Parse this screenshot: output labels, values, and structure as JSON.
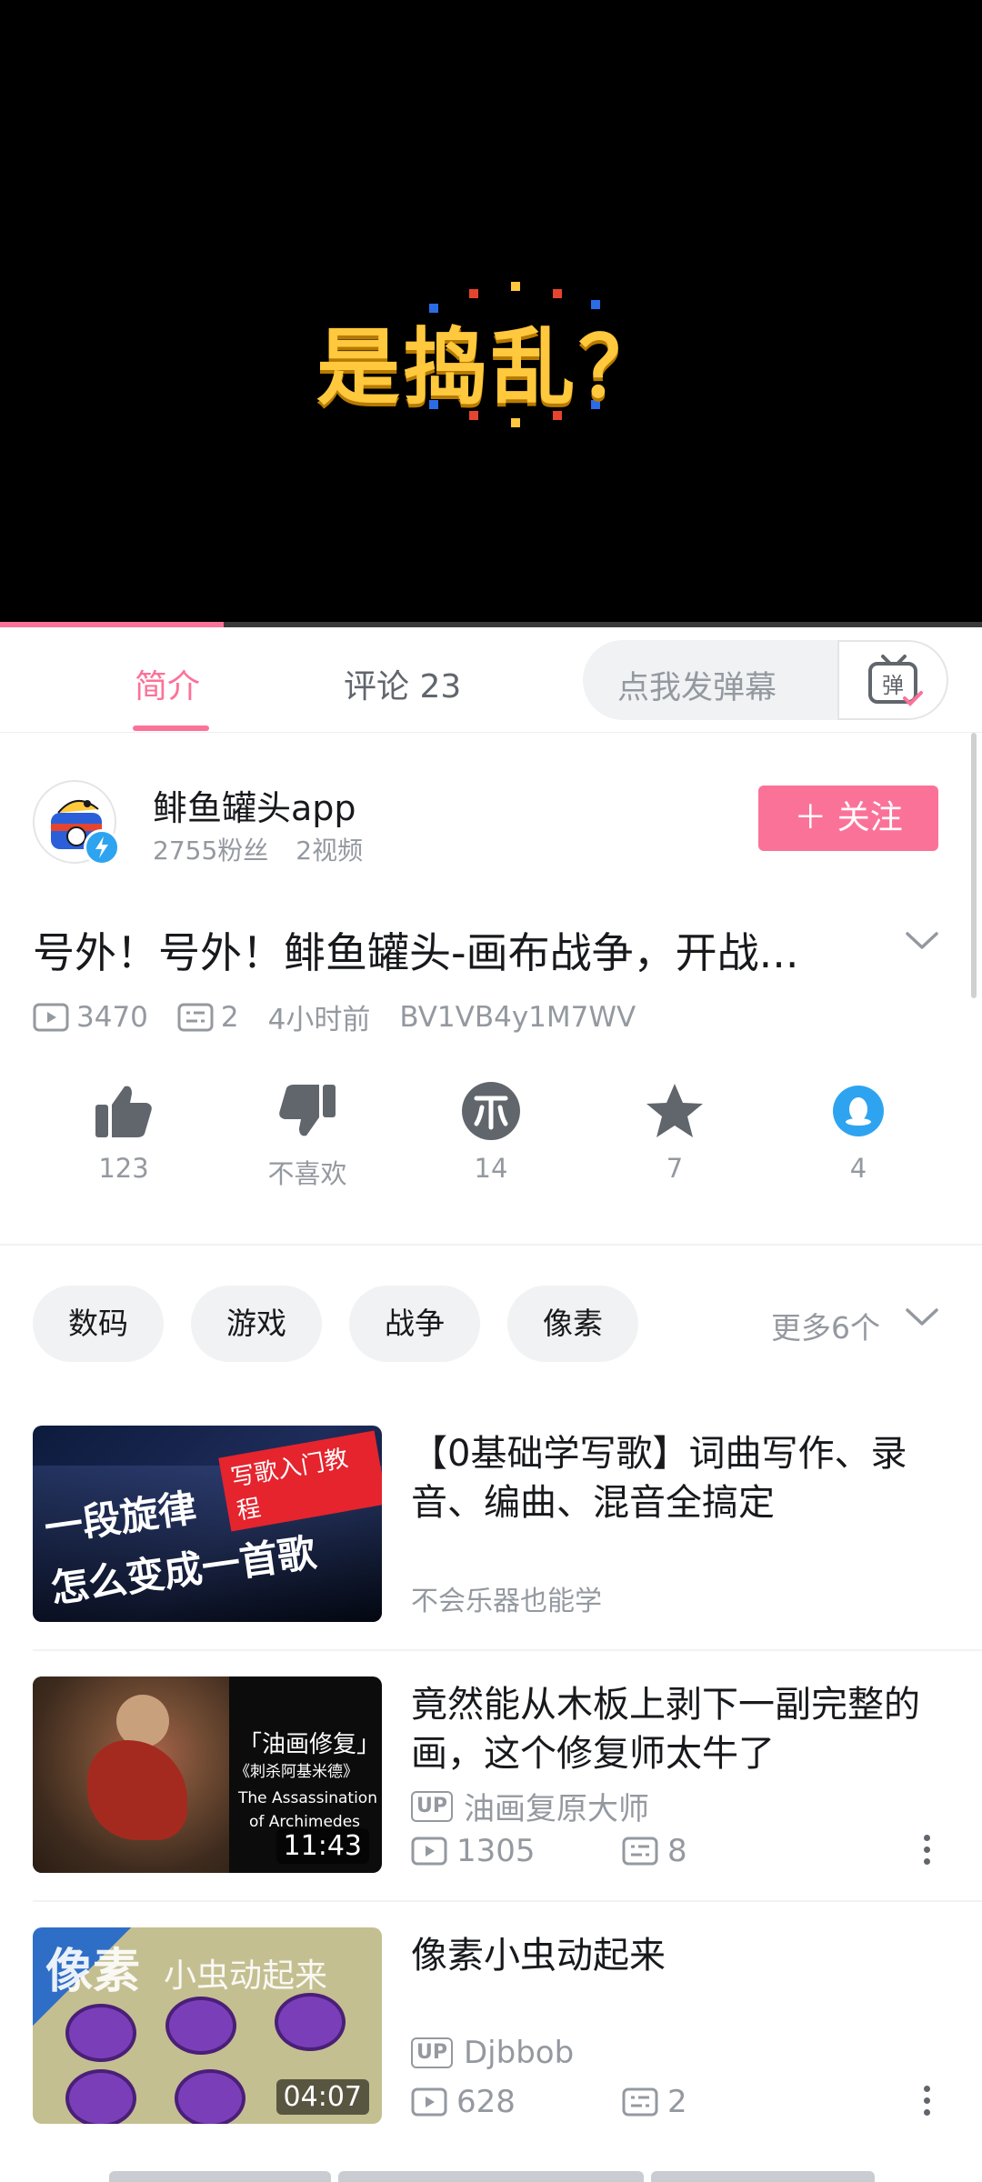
{
  "video": {
    "overlay_text": "是捣乱？",
    "progress_fraction": 0.228
  },
  "tabs": {
    "intro": "简介",
    "comments": "评论 23",
    "danmaku_placeholder": "点我发弹幕",
    "danmaku_button": "弹"
  },
  "uploader": {
    "name": "鲱鱼罐头app",
    "fans": "2755粉丝",
    "videos": "2视频",
    "follow_label": "关注",
    "follow_plus": "＋"
  },
  "video_info": {
    "title": "号外！号外！鲱鱼罐头-画布战争，开战...",
    "views": "3470",
    "danmaku": "2",
    "time": "4小时前",
    "bvid": "BV1VB4y1M7WV"
  },
  "actions": [
    {
      "icon": "thumbs-up-icon",
      "label": "123"
    },
    {
      "icon": "thumbs-down-icon",
      "label": "不喜欢"
    },
    {
      "icon": "coin-icon",
      "label": "14"
    },
    {
      "icon": "star-icon",
      "label": "7"
    },
    {
      "icon": "qq-share-icon",
      "label": "4"
    }
  ],
  "tags": [
    "数码",
    "游戏",
    "战争",
    "像素"
  ],
  "tags_more": "更多6个",
  "recommendations": [
    {
      "title": "【0基础学写歌】词曲写作、录音、编曲、混音全搞定",
      "subtitle": "不会乐器也能学",
      "thumb_text_1": "一段旋律",
      "thumb_text_2": "怎么变成一首歌",
      "thumb_badge": "写歌入门教程"
    },
    {
      "title": "竟然能从木板上剥下一副完整的画，这个修复师太牛了",
      "uploader": "油画复原大师",
      "views": "1305",
      "danmaku": "8",
      "duration": "11:43",
      "thumb_text_1": "「油画修复」",
      "thumb_text_2": "《刺杀阿基米德》",
      "thumb_text_3": "The Assassination",
      "thumb_text_4": "of Archimedes"
    },
    {
      "title": "像素小虫动起来",
      "uploader": "Djbbob",
      "views": "628",
      "danmaku": "2",
      "duration": "04:07",
      "thumb_text_1": "像素",
      "thumb_text_2": "小虫动起来"
    }
  ],
  "up_badge": "UP",
  "colors": {
    "accent": "#fb7299",
    "gray": "#9499a0"
  }
}
